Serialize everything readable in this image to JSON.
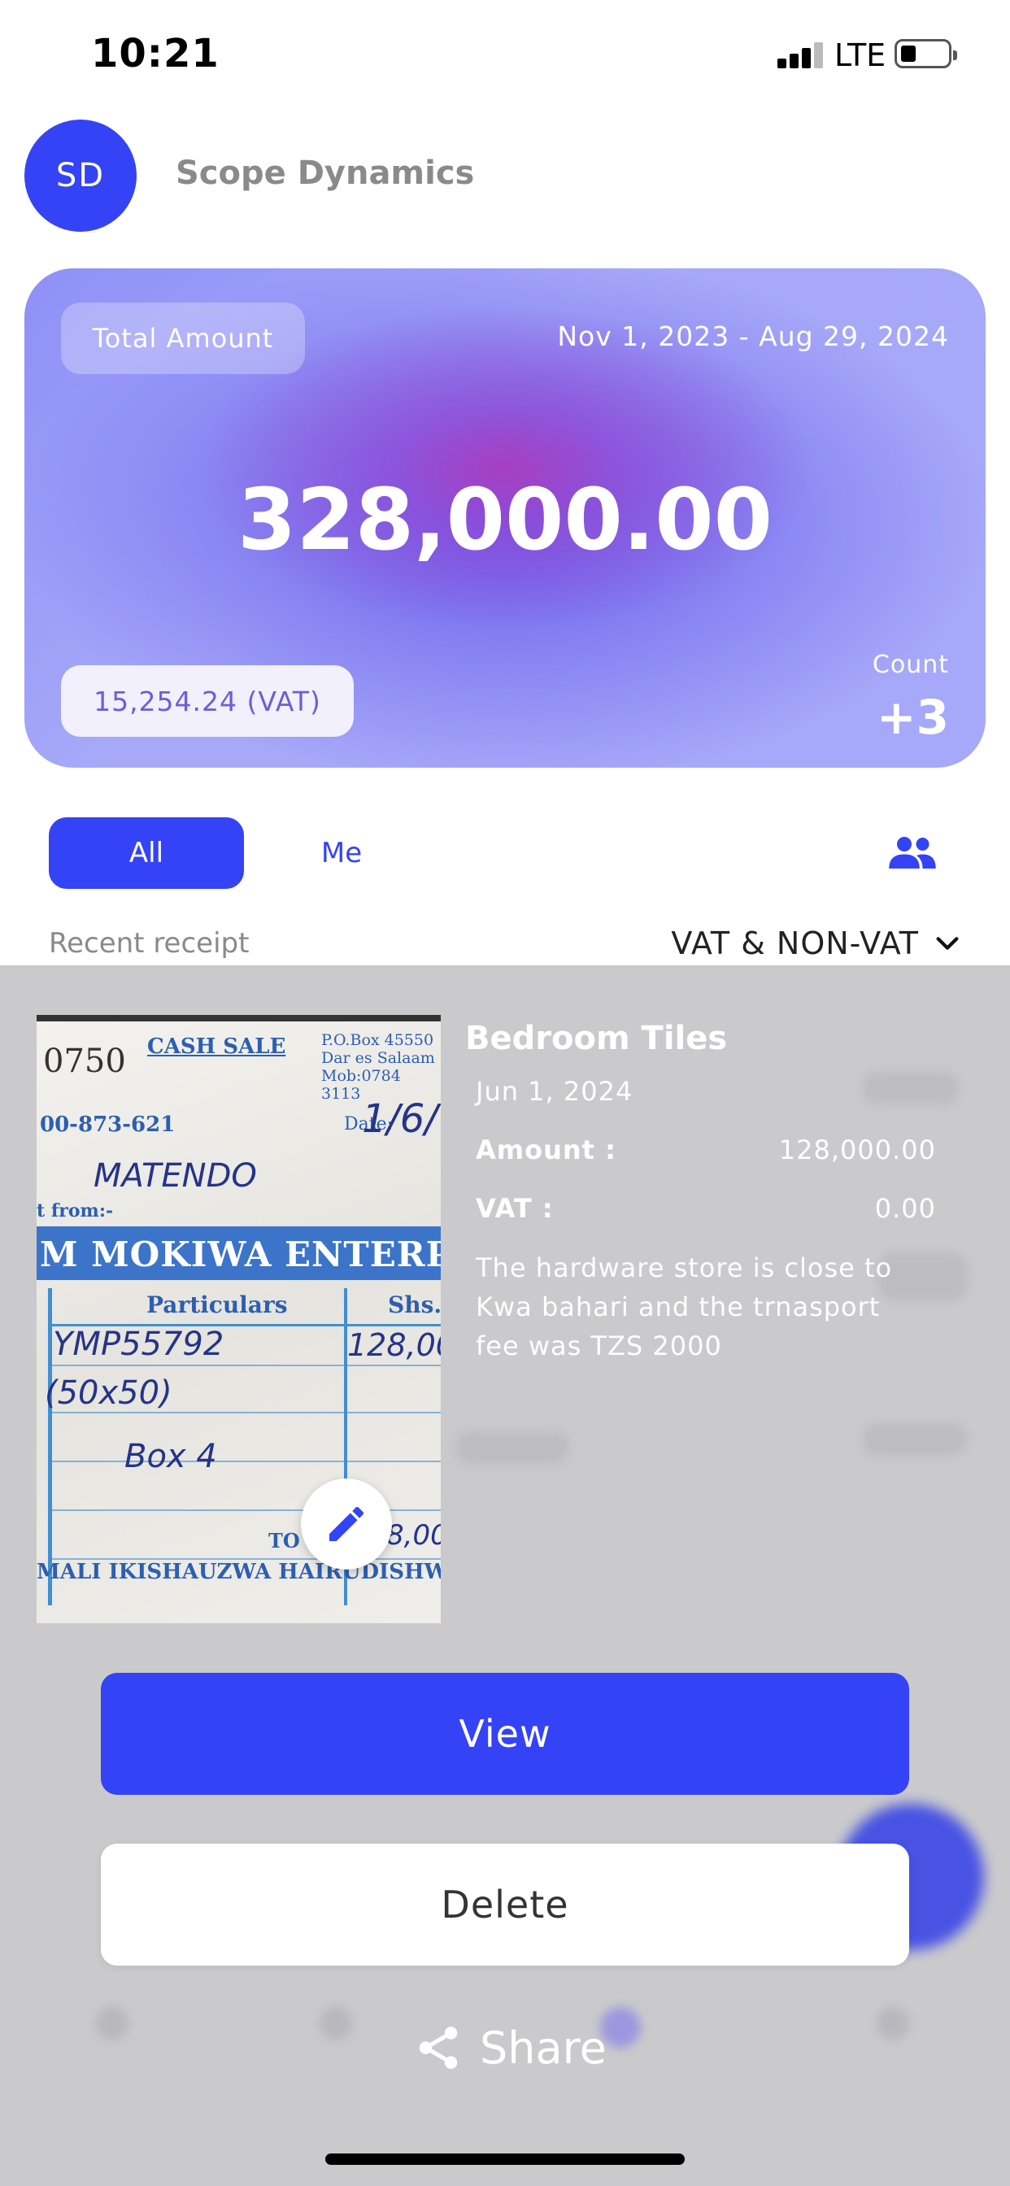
{
  "status_bar": {
    "time": "10:21",
    "network": "LTE"
  },
  "header": {
    "avatar_initials": "SD",
    "company_name": "Scope Dynamics"
  },
  "summary_card": {
    "chip_label": "Total Amount",
    "date_range": "Nov 1, 2023 - Aug 29, 2024",
    "total_amount": "328,000.00",
    "vat_chip": "15,254.24 (VAT)",
    "count_label": "Count",
    "count_value": "+3"
  },
  "filters": {
    "all_label": "All",
    "me_label": "Me",
    "selected": "All",
    "team_icon": "people-icon"
  },
  "list_header": {
    "recent_label": "Recent receipt",
    "vat_filter": "VAT & NON-VAT"
  },
  "receipt_preview": {
    "image_text": {
      "number": "0750",
      "cash_sale": "CASH SALE",
      "po_box": "P.O.Box 45550",
      "city": "Dar es Salaam",
      "mob": "Mob:0784 3113",
      "phone": "00-873-621",
      "date_label": "Date:",
      "date_value": "1/6/",
      "from_label": "t from:-",
      "customer": "MATENDO",
      "business": "M MOKIWA ENTERPRI",
      "particulars": "Particulars",
      "shs": "Shs.",
      "item_code": "YMP55792",
      "item_size": "(50x50)",
      "item_qty": "Box 4",
      "item_amount": "128,00",
      "total_label": "TO",
      "total_amount": "8,00",
      "footer": "MALI IKISHAUZWA HAIRUDISHW"
    },
    "edit_icon": "pencil-icon"
  },
  "receipt_detail": {
    "title": "Bedroom Tiles",
    "date": "Jun 1, 2024",
    "amount_label": "Amount :",
    "amount_value": "128,000.00",
    "vat_label": "VAT :",
    "vat_value": "0.00",
    "note": "The hardware store is close to Kwa bahari and the trnasport fee was TZS 2000"
  },
  "actions": {
    "view_label": "View",
    "delete_label": "Delete",
    "share_label": "Share",
    "share_icon": "share-icon"
  },
  "colors": {
    "primary": "#3443f5",
    "overlay": "#c8c8ca"
  }
}
